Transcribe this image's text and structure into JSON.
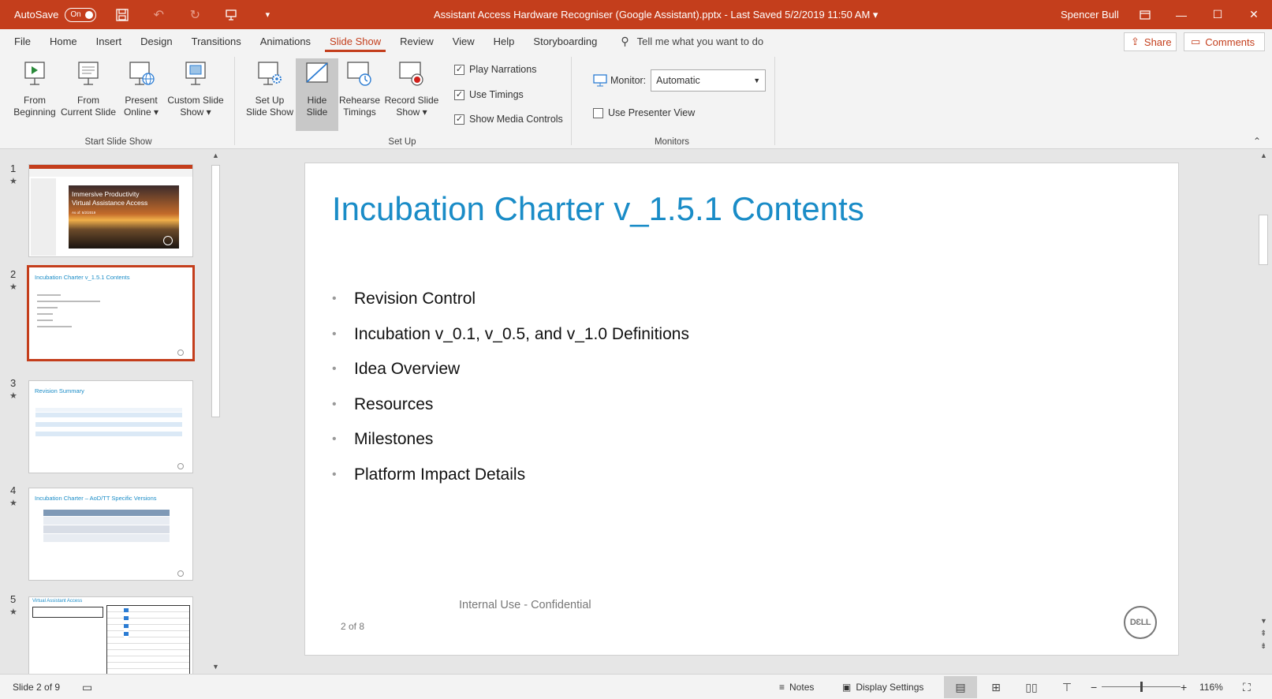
{
  "titlebar": {
    "autosave_label": "AutoSave",
    "autosave_state": "On",
    "title": "Assistant Access Hardware Recogniser (Google Assistant).pptx  -  Last Saved 5/2/2019 11:50 AM  ▾",
    "user": "Spencer Bull"
  },
  "tabs": [
    {
      "label": "File"
    },
    {
      "label": "Home"
    },
    {
      "label": "Insert"
    },
    {
      "label": "Design"
    },
    {
      "label": "Transitions"
    },
    {
      "label": "Animations"
    },
    {
      "label": "Slide Show"
    },
    {
      "label": "Review"
    },
    {
      "label": "View"
    },
    {
      "label": "Help"
    },
    {
      "label": "Storyboarding"
    }
  ],
  "tell_me": "Tell me what you want to do",
  "share_label": "Share",
  "comments_label": "Comments",
  "ribbon": {
    "start": {
      "from_beginning": [
        "From",
        "Beginning"
      ],
      "from_current": [
        "From",
        "Current Slide"
      ],
      "present_online": [
        "Present",
        "Online ▾"
      ],
      "custom_show": [
        "Custom Slide",
        "Show ▾"
      ],
      "group": "Start Slide Show"
    },
    "setup": {
      "setup_show": [
        "Set Up",
        "Slide Show"
      ],
      "hide_slide": [
        "Hide",
        "Slide"
      ],
      "rehearse": [
        "Rehearse",
        "Timings"
      ],
      "record": [
        "Record Slide",
        "Show ▾"
      ],
      "play_narrations": "Play Narrations",
      "use_timings": "Use Timings",
      "show_media": "Show Media Controls",
      "group": "Set Up"
    },
    "monitors": {
      "monitor_label": "Monitor:",
      "monitor_value": "Automatic",
      "presenter_view": "Use Presenter View",
      "group": "Monitors"
    }
  },
  "thumbnails": [
    {
      "num": "1",
      "title": "Immersive Productivity\nVirtual Assistance Access",
      "sub": "As of: 5/2/2019"
    },
    {
      "num": "2",
      "title": "Incubation Charter v_1.5.1 Contents"
    },
    {
      "num": "3",
      "title": "Revision Summary"
    },
    {
      "num": "4",
      "title": "Incubation Charter – AoD/TT Specific Versions"
    },
    {
      "num": "5",
      "title": "Virtual Assistant Access"
    }
  ],
  "slide": {
    "title": "Incubation Charter v_1.5.1 Contents",
    "bullets": [
      "Revision Control",
      "Incubation v_0.1, v_0.5, and v_1.0 Definitions",
      "Idea Overview",
      "Resources",
      "Milestones",
      "Platform Impact Details"
    ],
    "footer": "Internal Use - Confidential",
    "page": "2 of 8",
    "logo_text": "DƐLL"
  },
  "status": {
    "slide_info": "Slide 2 of 9",
    "notes": "Notes",
    "display_settings": "Display Settings",
    "zoom": "116%"
  },
  "colors": {
    "accent": "#c43e1c",
    "title_blue": "#1a8cc7"
  }
}
